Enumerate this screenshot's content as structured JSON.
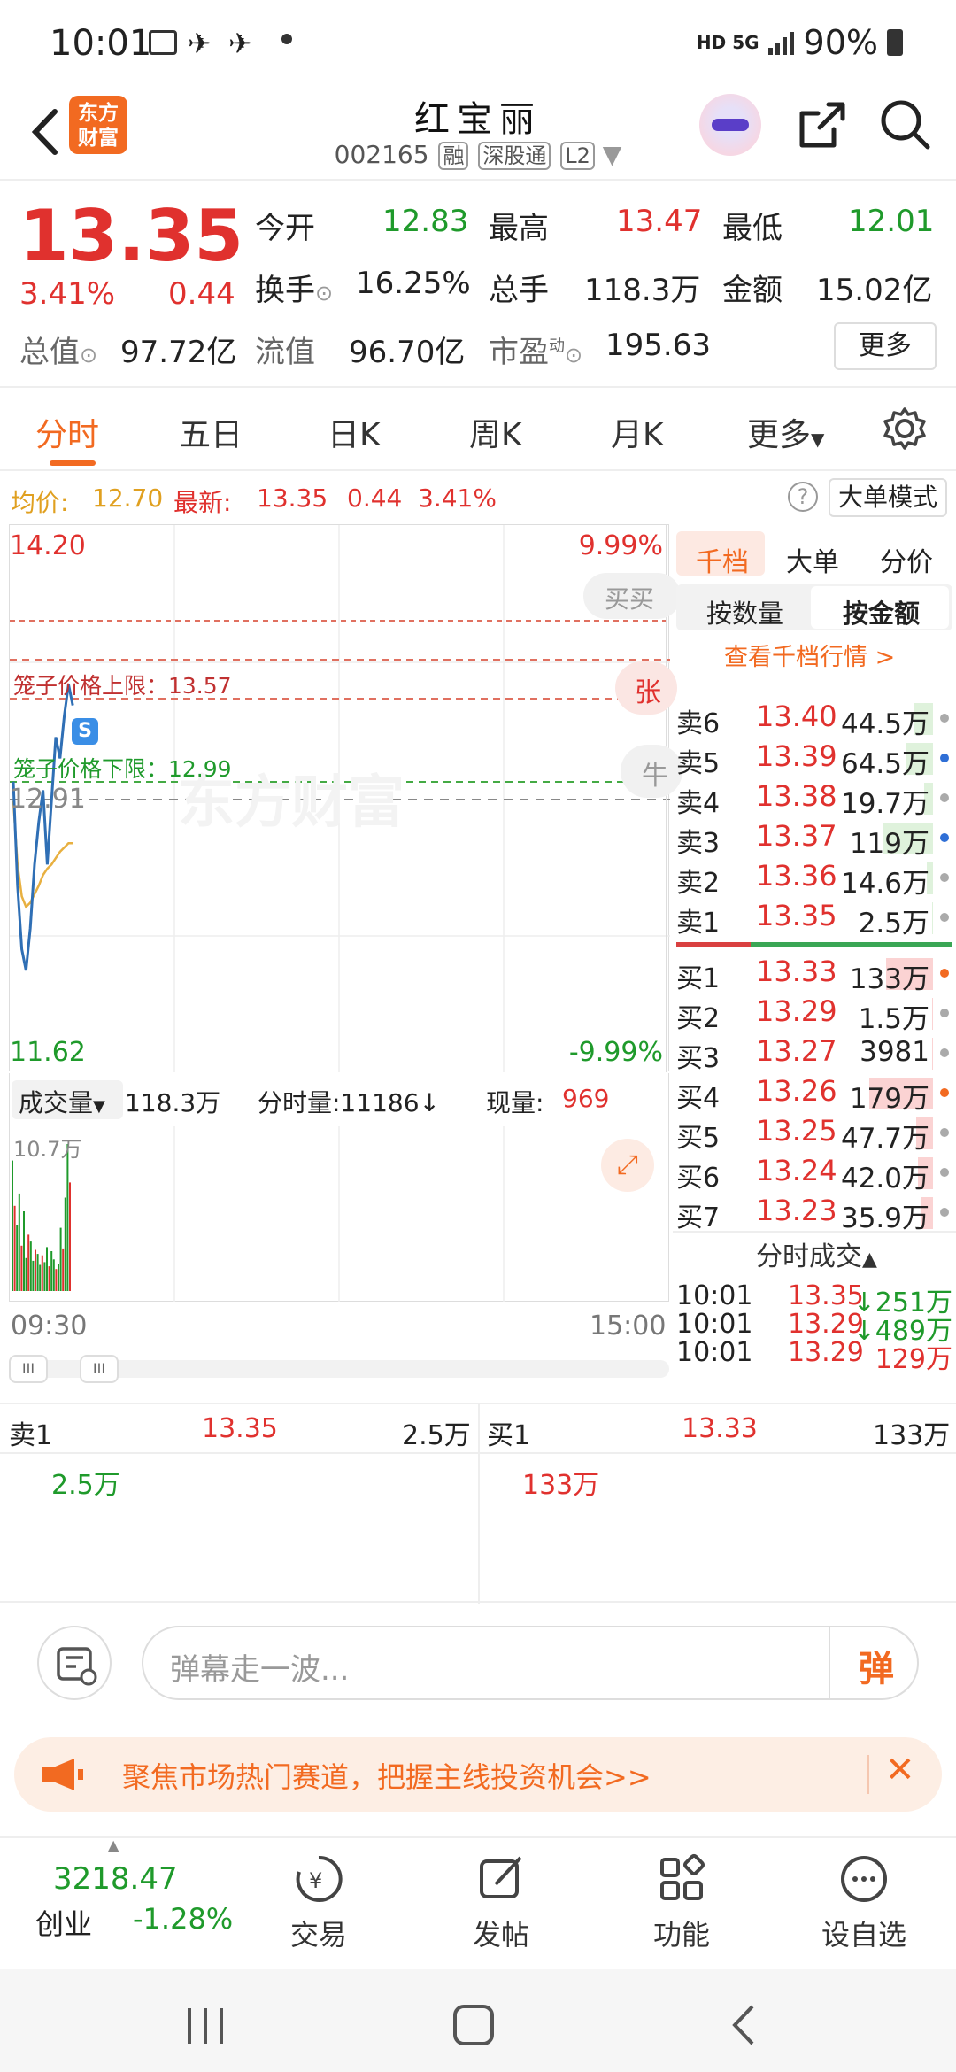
{
  "status": {
    "time": "10:01",
    "network": "HD 5G",
    "battery": "90%"
  },
  "header": {
    "logo_line1": "东方",
    "logo_line2": "财富",
    "title": "红宝丽",
    "code": "002165",
    "tag1": "融",
    "tag2": "深股通",
    "tag3": "L2"
  },
  "quote": {
    "price": "13.35",
    "pct": "3.41%",
    "change": "0.44",
    "open_label": "今开",
    "open": "12.83",
    "high_label": "最高",
    "high": "13.47",
    "low_label": "最低",
    "low": "12.01",
    "turnover_label": "换手",
    "turnover": "16.25%",
    "vol_label": "总手",
    "vol": "118.3万",
    "amount_label": "金额",
    "amount": "15.02亿",
    "mcap_label": "总值",
    "mcap": "97.72亿",
    "float_label": "流值",
    "float": "96.70亿",
    "pe_label": "市盈",
    "pe_sup": "动",
    "pe": "195.63",
    "more": "更多"
  },
  "tabs": [
    "分时",
    "五日",
    "日K",
    "周K",
    "月K",
    "更多"
  ],
  "infoline": {
    "avg_label": "均价:",
    "avg": "12.70",
    "latest_label": "最新:",
    "latest": "13.35",
    "chg": "0.44",
    "pct": "3.41%",
    "mode": "大单模式"
  },
  "chart": {
    "top_price": "14.20",
    "top_pct": "9.99%",
    "bottom_price": "11.62",
    "bottom_pct": "-9.99%",
    "prev_close": "12.91",
    "cage_upper": "笼子价格上限：13.57",
    "cage_lower": "笼子价格下限：12.99",
    "buy_hint": "买买",
    "up_hint": "张",
    "down_hint": "牛",
    "watermark": "东方财富",
    "vol_select": "成交量",
    "vol_total": "118.3万",
    "min_vol": "分时量:11186↓",
    "now_vol_label": "现量:",
    "now_vol": "969",
    "vol_max": "10.7万",
    "t_start": "09:30",
    "t_end": "15:00"
  },
  "chart_data": {
    "type": "line",
    "ylim": [
      11.62,
      14.2
    ],
    "series": [
      {
        "name": "最新",
        "values": [
          12.99,
          12.5,
          12.2,
          12.1,
          12.3,
          12.6,
          12.8,
          12.95,
          12.6,
          12.9,
          13.2,
          13.1,
          13.3,
          13.45,
          13.35
        ]
      },
      {
        "name": "均价",
        "values": [
          12.9,
          12.6,
          12.45,
          12.4,
          12.42,
          12.46,
          12.5,
          12.55,
          12.58,
          12.6,
          12.63,
          12.66,
          12.68,
          12.7,
          12.7
        ]
      }
    ],
    "volume": [
      9.5,
      6.2,
      4.8,
      7.1,
      3.3,
      5.8,
      2.4,
      4.1,
      3.6,
      2.2,
      3.0,
      2.7,
      1.9,
      2.6,
      2.1,
      3.2,
      1.8,
      2.9,
      2.3,
      1.6,
      2.0,
      4.6,
      3.1,
      6.8,
      10.7,
      7.9
    ]
  },
  "book": {
    "tabs": [
      "千档",
      "大单",
      "分价"
    ],
    "subtabs": [
      "按数量",
      "按金额"
    ],
    "view_more": "查看千档行情 >",
    "asks": [
      {
        "label": "卖6",
        "price": "13.40",
        "vol": "44.5万"
      },
      {
        "label": "卖5",
        "price": "13.39",
        "vol": "64.5万"
      },
      {
        "label": "卖4",
        "price": "13.38",
        "vol": "19.7万"
      },
      {
        "label": "卖3",
        "price": "13.37",
        "vol": "119万"
      },
      {
        "label": "卖2",
        "price": "13.36",
        "vol": "14.6万"
      },
      {
        "label": "卖1",
        "price": "13.35",
        "vol": "2.5万"
      }
    ],
    "bids": [
      {
        "label": "买1",
        "price": "13.33",
        "vol": "133万"
      },
      {
        "label": "买2",
        "price": "13.29",
        "vol": "1.5万"
      },
      {
        "label": "买3",
        "price": "13.27",
        "vol": "3981"
      },
      {
        "label": "买4",
        "price": "13.26",
        "vol": "179万"
      },
      {
        "label": "买5",
        "price": "13.25",
        "vol": "47.7万"
      },
      {
        "label": "买6",
        "price": "13.24",
        "vol": "42.0万"
      },
      {
        "label": "买7",
        "price": "13.23",
        "vol": "35.9万"
      }
    ],
    "trade_title": "分时成交",
    "trades": [
      {
        "time": "10:01",
        "price": "13.35",
        "vol": "↓251万"
      },
      {
        "time": "10:01",
        "price": "13.29",
        "vol": "↓489万"
      },
      {
        "time": "10:01",
        "price": "13.29",
        "vol": "129万"
      }
    ]
  },
  "summary": {
    "sell_label": "卖1",
    "sell_price": "13.35",
    "sell_vol": "2.5万",
    "sell_detail": "2.5万",
    "buy_label": "买1",
    "buy_price": "13.33",
    "buy_vol": "133万",
    "buy_detail": "133万"
  },
  "danmu": {
    "placeholder": "弹幕走一波...",
    "btn": "弹"
  },
  "banner": {
    "text": "聚焦市场热门赛道，把握主线投资机会>>"
  },
  "bottomnav": {
    "index_value": "3218.47",
    "index_name": "创业",
    "index_pct": "-1.28%",
    "items": [
      "交易",
      "发帖",
      "功能",
      "设自选"
    ]
  }
}
